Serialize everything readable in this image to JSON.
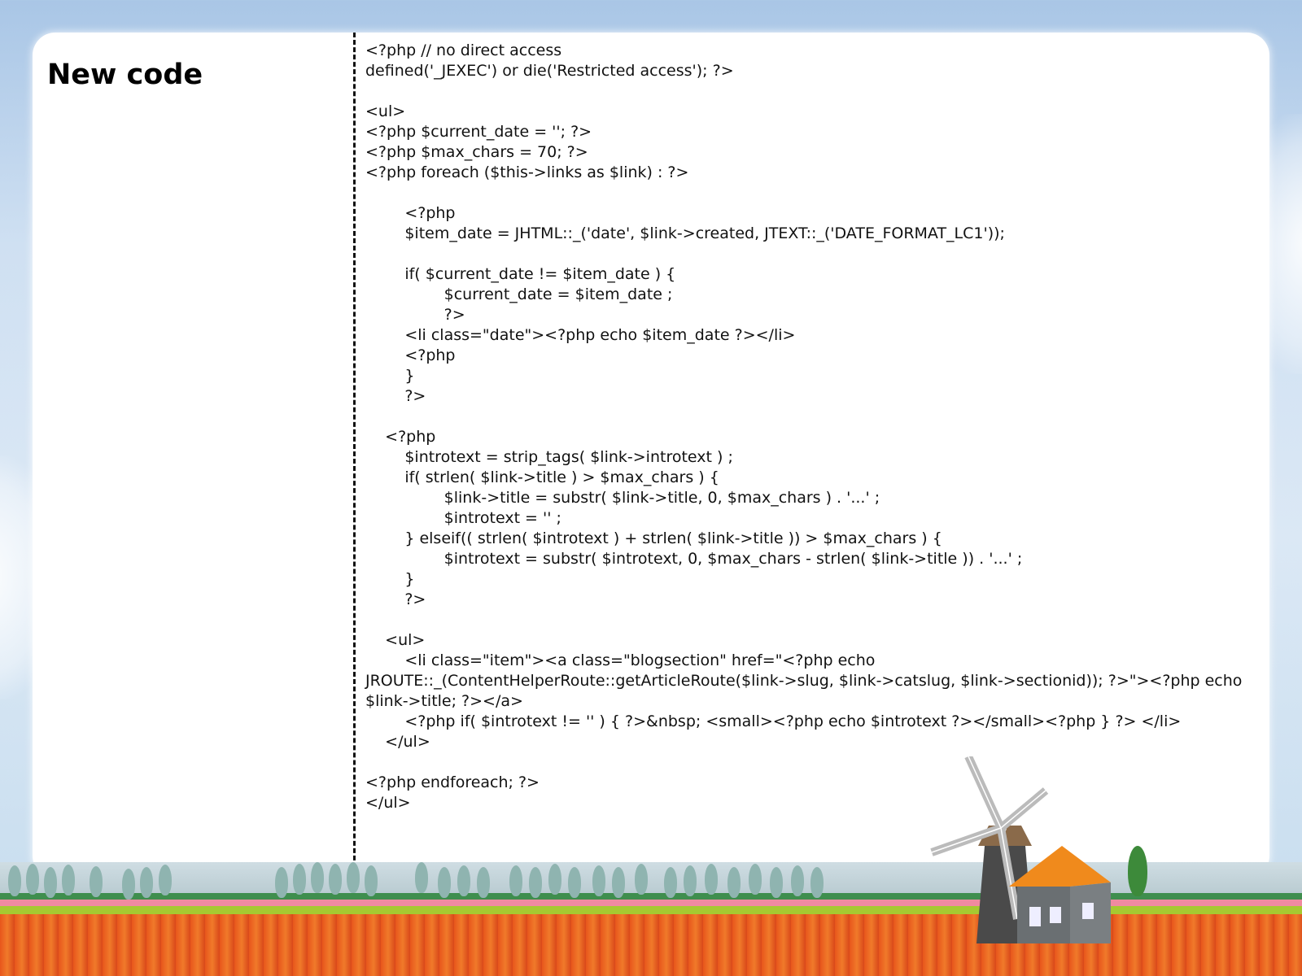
{
  "slide": {
    "title": "New code",
    "code": "<?php // no direct access\ndefined('_JEXEC') or die('Restricted access'); ?>\n\n<ul>\n<?php $current_date = ''; ?>\n<?php $max_chars = 70; ?>\n<?php foreach ($this->links as $link) : ?>\n\n\t<?php\n\t$item_date = JHTML::_('date', $link->created, JTEXT::_('DATE_FORMAT_LC1'));\n\n\tif( $current_date != $item_date ) {\n\t\t$current_date = $item_date ;\n\t\t?>\n        <li class=\"date\"><?php echo $item_date ?></li>\n        <?php\n\t}\n\t?>\n\n    <?php\n\t$introtext = strip_tags( $link->introtext ) ;\n\tif( strlen( $link->title ) > $max_chars ) {\n\t\t$link->title = substr( $link->title, 0, $max_chars ) . '...' ;\n\t\t$introtext = '' ;\n\t} elseif(( strlen( $introtext ) + strlen( $link->title )) > $max_chars ) {\n\t\t$introtext = substr( $introtext, 0, $max_chars - strlen( $link->title )) . '...' ;\n\t}\n\t?>\n\n    <ul>\n        <li class=\"item\"><a class=\"blogsection\" href=\"<?php echo JROUTE::_(ContentHelperRoute::getArticleRoute($link->slug, $link->catslug, $link->sectionid)); ?>\"><?php echo $link->title; ?></a>\n        <?php if( $introtext != '' ) { ?>&nbsp; <small><?php echo $introtext ?></small><?php } ?> </li>\n    </ul>\n\n<?php endforeach; ?>\n</ul>"
  },
  "decoration": {
    "sky_color": "#c9dcf0",
    "field_colors": [
      "#3f8e4e",
      "#f08aa0",
      "#a6c931",
      "#e8561c"
    ],
    "windmill_roof": "#f08a1c"
  }
}
